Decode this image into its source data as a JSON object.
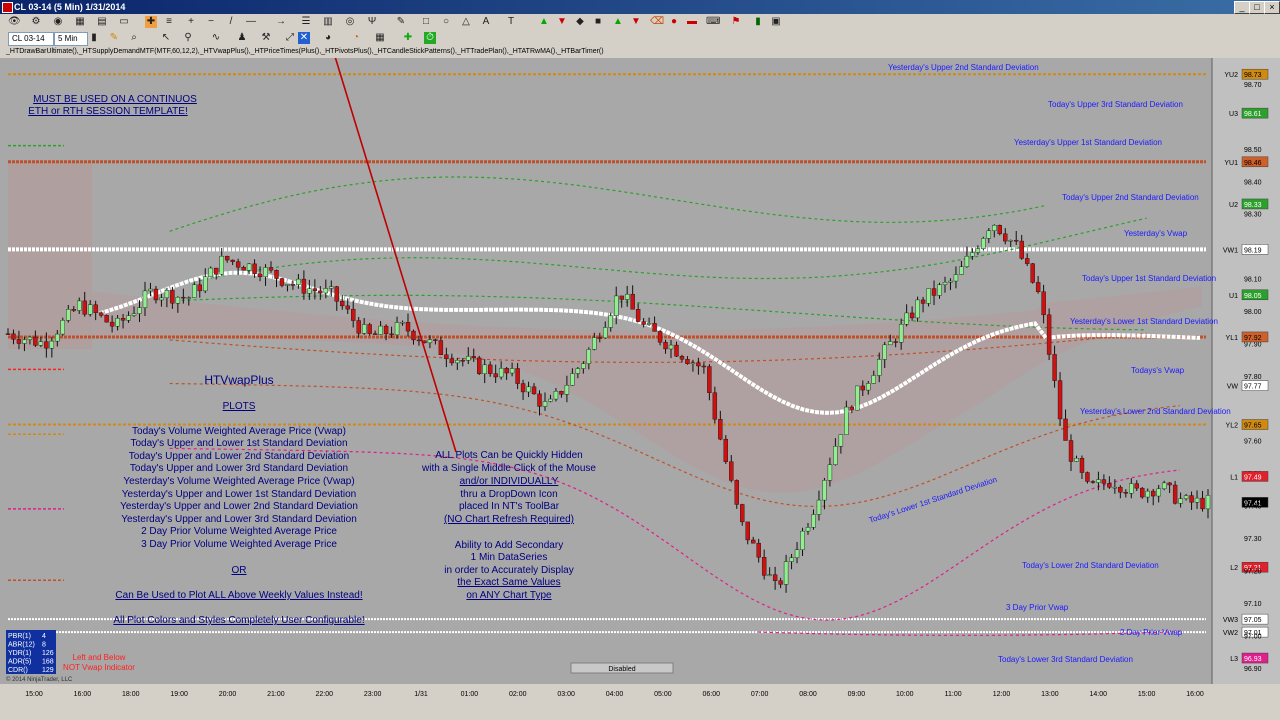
{
  "window": {
    "title": "CL 03-14 (5 Min)  1/31/2014",
    "minimize_label": "_",
    "maximize_label": "□",
    "close_label": "×"
  },
  "toolbar": {
    "instrument": "CL 03-14",
    "interval": "5 Min"
  },
  "indicators_line": "_HTDrawBarUltimate(),_HTSupplyDemandMTF(MTF,60,12,2),_HTVwapPlus(),_HTPriceTimes(Plus(),_HTPivotsPlus(),_HTCandleStickPatterns(),_HTTradePlan(),_HTATRwMA(),_HTBarTimer()",
  "notes": {
    "template_line1": "MUST BE USED ON A CONTINUOS",
    "template_line2": "ETH or RTH SESSION TEMPLATE!",
    "title": "HTVwapPlus",
    "plots_header": "PLOTS",
    "plots": [
      "Today's Volume Weighted Average Price (Vwap)",
      "Today's Upper and Lower 1st Standard Deviation",
      "Today's Upper and Lower 2nd Standard Deviation",
      "Today's Upper and Lower 3rd Standard Deviation",
      "Yesterday's Volume Weighted Average Price (Vwap)",
      "Yesterday's  Upper and Lower 1st Standard Deviation",
      "Yesterday's Upper and Lower 2nd Standard Deviation",
      "Yesterday's Upper and Lower 3rd Standard Deviation",
      "2 Day Prior Volume Weighted Average Price",
      "3 Day Prior Volume Weighted Average Price"
    ],
    "or": "OR",
    "weekly": "Can Be Used to Plot ALL Above Weekly Values Instead!",
    "configurable": "All Plot Colors and Styles Completely User Configurable!",
    "hide_lines": [
      "ALL Plots Can be Quickly Hidden",
      "with a Single Middle Click of the Mouse",
      "and/or INDIVIDUALLY",
      "thru a DropDown Icon",
      "placed In NT's ToolBar",
      "(NO Chart Refresh Required)"
    ],
    "secondary_lines": [
      "Ability to Add Secondary",
      "1 Min DataSeries",
      "in order to Accurately Display",
      "the Exact Same Values",
      "on ANY Chart Type"
    ]
  },
  "line_labels": {
    "yu2": "Yesterday's Upper 2nd Standard Deviation",
    "u3": "Today's Upper 3rd Standard Deviation",
    "yu1": "Yesterday's Upper 1st Standard Deviation",
    "u2": "Today's Upper 2nd Standard Deviation",
    "yvwap": "Yesterday's Vwap",
    "u1": "Today's Upper 1st Standard Deviation",
    "yl1": "Yesterday's Lower 1st Standard Deviation",
    "vwap": "Todays's Vwap",
    "yl2": "Yesterday's Lower 2nd Standard Deviation",
    "l1": "Today's Lower 1st Standard Deviation",
    "l2": "Today's Lower 2nd Standard Deviation",
    "vw3": "3 Day Prior Vwap",
    "vw2": "2 Day Prior Vwap",
    "l3": "Today's Lower 3rd Standard Deviation"
  },
  "price_axis": [
    {
      "tag": "YU2",
      "price": "98.73",
      "color": "#d08a10"
    },
    {
      "tag": "",
      "price": "98.70",
      "color": ""
    },
    {
      "tag": "U3",
      "price": "98.61",
      "color": "#2ca02c"
    },
    {
      "tag": "",
      "price": "98.50",
      "color": ""
    },
    {
      "tag": "YU1",
      "price": "98.46",
      "color": "#d0602a"
    },
    {
      "tag": "",
      "price": "98.40",
      "color": ""
    },
    {
      "tag": "U2",
      "price": "98.33",
      "color": "#2ca02c"
    },
    {
      "tag": "",
      "price": "98.30",
      "color": ""
    },
    {
      "tag": "",
      "price": "98.20",
      "color": ""
    },
    {
      "tag": "VW1",
      "price": "98.19",
      "color": "#ffffff"
    },
    {
      "tag": "",
      "price": "98.10",
      "color": ""
    },
    {
      "tag": "U1",
      "price": "98.05",
      "color": "#2ca02c"
    },
    {
      "tag": "",
      "price": "98.00",
      "color": ""
    },
    {
      "tag": "",
      "price": "97.90",
      "color": ""
    },
    {
      "tag": "YL1",
      "price": "97.92",
      "color": "#d0602a"
    },
    {
      "tag": "",
      "price": "97.80",
      "color": ""
    },
    {
      "tag": "VW",
      "price": "97.77",
      "color": "#ffffff"
    },
    {
      "tag": "YL2",
      "price": "97.65",
      "color": "#d08a10"
    },
    {
      "tag": "",
      "price": "97.60",
      "color": ""
    },
    {
      "tag": "",
      "price": "97.50",
      "color": ""
    },
    {
      "tag": "L1",
      "price": "97.49",
      "color": "#e0202a"
    },
    {
      "tag": "",
      "price": "97.41",
      "color": "#000000"
    },
    {
      "tag": "",
      "price": "97.40",
      "color": ""
    },
    {
      "tag": "",
      "price": "97.30",
      "color": ""
    },
    {
      "tag": "L2",
      "price": "97.21",
      "color": "#e0202a"
    },
    {
      "tag": "",
      "price": "97.20",
      "color": ""
    },
    {
      "tag": "",
      "price": "97.10",
      "color": ""
    },
    {
      "tag": "VW3",
      "price": "97.05",
      "color": "#ffffff"
    },
    {
      "tag": "VW2",
      "price": "97.01",
      "color": "#ffffff"
    },
    {
      "tag": "",
      "price": "97.00",
      "color": ""
    },
    {
      "tag": "L3",
      "price": "96.93",
      "color": "#e01e8c"
    },
    {
      "tag": "",
      "price": "96.90",
      "color": ""
    }
  ],
  "time_axis": [
    "15:00",
    "16:00",
    "18:00",
    "19:00",
    "20:00",
    "21:00",
    "22:00",
    "23:00",
    "1/31",
    "01:00",
    "02:00",
    "03:00",
    "04:00",
    "05:00",
    "06:00",
    "07:00",
    "08:00",
    "09:00",
    "10:00",
    "11:00",
    "12:00",
    "13:00",
    "14:00",
    "15:00",
    "16:00"
  ],
  "stats": [
    {
      "label": "PBR(1)",
      "value": "4"
    },
    {
      "label": "ABR(12)",
      "value": "8"
    },
    {
      "label": "YDR(1)",
      "value": "126"
    },
    {
      "label": "ADR(5)",
      "value": "168"
    },
    {
      "label": "CDR()",
      "value": "129"
    }
  ],
  "left_below_line1": "Left and Below",
  "left_below_line2": "NOT Vwap Indicator",
  "disabled_label": "Disabled",
  "copyright": "© 2014 NinjaTrader, LLC",
  "colors": {
    "chart_bg": "#a8a8a8",
    "up_candle": "#90ee90",
    "down_candle": "#cc1111",
    "label_blue": "#1a1aff",
    "note_navy": "#000080",
    "vwap_white": "#ffffff",
    "arrow_red": "#c00000"
  },
  "chart_data": {
    "type": "candlestick",
    "y_range": [
      96.85,
      98.78
    ],
    "x_labels": [
      "15:00",
      "16:00",
      "18:00",
      "19:00",
      "20:00",
      "21:00",
      "22:00",
      "23:00",
      "1/31",
      "01:00",
      "02:00",
      "03:00",
      "04:00",
      "05:00",
      "06:00",
      "07:00",
      "08:00",
      "09:00",
      "10:00",
      "11:00",
      "12:00",
      "13:00",
      "14:00",
      "15:00",
      "16:00"
    ],
    "levels": {
      "YU2": 98.73,
      "U3": 98.61,
      "YU1": 98.46,
      "U2": 98.33,
      "VW1": 98.19,
      "U1": 98.05,
      "YL1": 97.92,
      "VW": 97.77,
      "YL2": 97.65,
      "L1": 97.49,
      "L2": 97.21,
      "VW3": 97.05,
      "VW2": 97.01,
      "L3": 96.93
    },
    "close_path": [
      {
        "t": 0.0,
        "p": 97.93
      },
      {
        "t": 0.03,
        "p": 97.9
      },
      {
        "t": 0.06,
        "p": 98.02
      },
      {
        "t": 0.09,
        "p": 97.95
      },
      {
        "t": 0.12,
        "p": 98.06
      },
      {
        "t": 0.15,
        "p": 98.04
      },
      {
        "t": 0.18,
        "p": 98.16
      },
      {
        "t": 0.21,
        "p": 98.13
      },
      {
        "t": 0.24,
        "p": 98.08
      },
      {
        "t": 0.27,
        "p": 98.05
      },
      {
        "t": 0.3,
        "p": 97.92
      },
      {
        "t": 0.33,
        "p": 97.95
      },
      {
        "t": 0.36,
        "p": 97.88
      },
      {
        "t": 0.39,
        "p": 97.83
      },
      {
        "t": 0.42,
        "p": 97.8
      },
      {
        "t": 0.45,
        "p": 97.7
      },
      {
        "t": 0.48,
        "p": 97.85
      },
      {
        "t": 0.51,
        "p": 98.06
      },
      {
        "t": 0.53,
        "p": 97.95
      },
      {
        "t": 0.55,
        "p": 97.9
      },
      {
        "t": 0.58,
        "p": 97.82
      },
      {
        "t": 0.61,
        "p": 97.35
      },
      {
        "t": 0.64,
        "p": 97.14
      },
      {
        "t": 0.67,
        "p": 97.38
      },
      {
        "t": 0.7,
        "p": 97.7
      },
      {
        "t": 0.73,
        "p": 97.87
      },
      {
        "t": 0.76,
        "p": 98.03
      },
      {
        "t": 0.79,
        "p": 98.1
      },
      {
        "t": 0.82,
        "p": 98.28
      },
      {
        "t": 0.84,
        "p": 98.2
      },
      {
        "t": 0.86,
        "p": 98.04
      },
      {
        "t": 0.88,
        "p": 97.6
      },
      {
        "t": 0.9,
        "p": 97.45
      },
      {
        "t": 0.92,
        "p": 97.48
      },
      {
        "t": 0.94,
        "p": 97.44
      },
      {
        "t": 0.96,
        "p": 97.46
      },
      {
        "t": 0.98,
        "p": 97.41
      }
    ]
  }
}
